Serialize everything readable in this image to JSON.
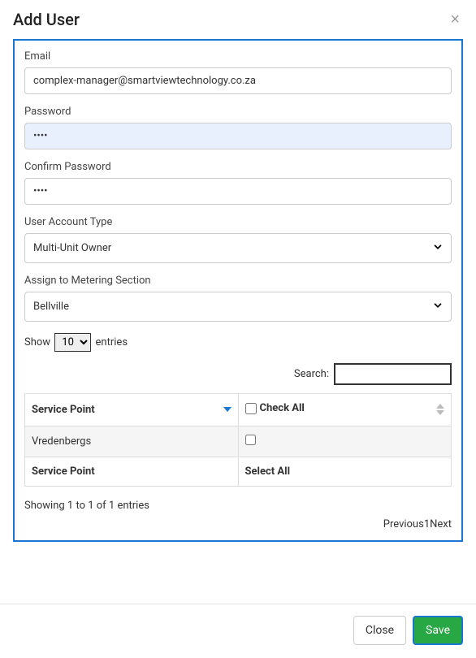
{
  "modal": {
    "title": "Add User"
  },
  "form": {
    "email": {
      "label": "Email",
      "value": "complex-manager@smartviewtechnology.co.za"
    },
    "password": {
      "label": "Password",
      "value": "••••"
    },
    "confirm_password": {
      "label": "Confirm Password",
      "value": "••••"
    },
    "account_type": {
      "label": "User Account Type",
      "value": "Multi-Unit Owner"
    },
    "metering_section": {
      "label": "Assign to Metering Section",
      "value": "Bellville"
    }
  },
  "datatable": {
    "show_prefix": "Show",
    "show_value": "10",
    "show_suffix": "entries",
    "search_label": "Search:",
    "search_value": "",
    "header_col1": "Service Point",
    "header_col2": "Check All",
    "rows": [
      {
        "name": "Vredenbergs",
        "checked": false
      }
    ],
    "footer_col1": "Service Point",
    "footer_col2": "Select All",
    "info": "Showing 1 to 1 of 1 entries",
    "prev_label": "Previous",
    "page_current": "1",
    "next_label": "Next"
  },
  "footer": {
    "close": "Close",
    "save": "Save"
  }
}
